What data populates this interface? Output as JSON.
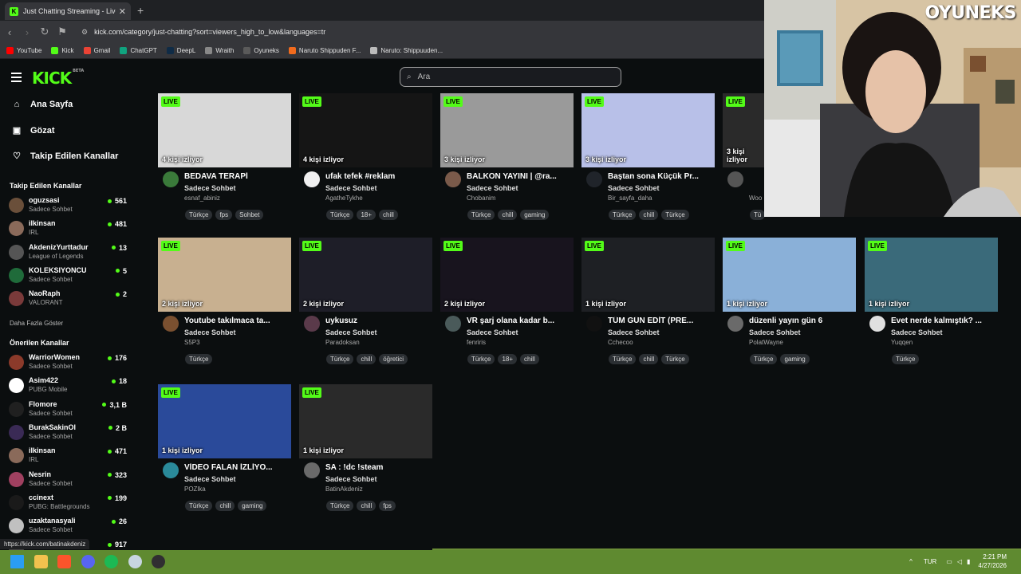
{
  "browser": {
    "tab_title": "Just Chatting Streaming - Live S",
    "url": "kick.com/category/just-chatting?sort=viewers_high_to_low&languages=tr",
    "bookmarks": [
      "YouTube",
      "Kick",
      "Gmail",
      "ChatGPT",
      "DeepL",
      "Wraith",
      "Oyuneks",
      "Naruto Shippuden F...",
      "Naruto: Shippuuden..."
    ],
    "bookmark_colors": [
      "#ff0000",
      "#53fc18",
      "#ea4335",
      "#10a37f",
      "#0f2b46",
      "#888888",
      "#5a5a5a",
      "#f26b1d",
      "#bbbbbb"
    ]
  },
  "header": {
    "logo": "KICK",
    "logo_badge": "BETA",
    "search_placeholder": "Ara"
  },
  "sidebar": {
    "nav": [
      {
        "label": "Ana Sayfa",
        "icon": "home-icon"
      },
      {
        "label": "Gözat",
        "icon": "browse-icon"
      },
      {
        "label": "Takip Edilen Kanallar",
        "icon": "heart-icon"
      }
    ],
    "followed_heading": "Takip Edilen Kanallar",
    "followed": [
      {
        "name": "oguzsasi",
        "sub": "Sadece Sohbet",
        "viewers": "561",
        "color": "#6a4f3a"
      },
      {
        "name": "ilkinsan",
        "sub": "IRL",
        "viewers": "481",
        "color": "#8a6a5a"
      },
      {
        "name": "AkdenizYurttadur",
        "sub": "League of Legends",
        "viewers": "13",
        "color": "#555555"
      },
      {
        "name": "KOLEKSIYONCU",
        "sub": "Sadece Sohbet",
        "viewers": "5",
        "color": "#1f6b3a"
      },
      {
        "name": "NaoRaph",
        "sub": "VALORANT",
        "viewers": "2",
        "color": "#7a3a3a"
      }
    ],
    "show_more": "Daha Fazla Göster",
    "recommended_heading": "Önerilen Kanallar",
    "recommended": [
      {
        "name": "WarriorWomen",
        "sub": "Sadece Sohbet",
        "viewers": "176",
        "color": "#8b3a2a"
      },
      {
        "name": "Asim422",
        "sub": "PUBG Mobile",
        "viewers": "18",
        "color": "#ffffff"
      },
      {
        "name": "Flomore",
        "sub": "Sadece Sohbet",
        "viewers": "3,1 B",
        "color": "#202020"
      },
      {
        "name": "BurakSakinOl",
        "sub": "Sadece Sohbet",
        "viewers": "2 B",
        "color": "#3a2a55"
      },
      {
        "name": "ilkinsan",
        "sub": "IRL",
        "viewers": "471",
        "color": "#8a6a5a"
      },
      {
        "name": "Nesrin",
        "sub": "Sadece Sohbet",
        "viewers": "323",
        "color": "#a04060"
      },
      {
        "name": "ccinext",
        "sub": "PUBG: Battlegrounds",
        "viewers": "199",
        "color": "#1a1a1a"
      },
      {
        "name": "uzaktanasyali",
        "sub": "Sadece Sohbet",
        "viewers": "26",
        "color": "#c0c0c0"
      },
      {
        "name": "",
        "sub": "",
        "viewers": "917",
        "color": "#444444"
      }
    ]
  },
  "live_label": "LIVE",
  "streams": [
    {
      "title": "BEDAVA TERAPİ",
      "category": "Sadece Sohbet",
      "user": "esnaf_abiniz",
      "viewers": "4 kişi izliyor",
      "tags": [
        "Türkçe",
        "fps",
        "Sohbet"
      ],
      "thumb": "#d8d8d8",
      "avatar": "#3a7a3a"
    },
    {
      "title": "ufak tefek #reklam",
      "category": "Sadece Sohbet",
      "user": "AgatheTykhe",
      "viewers": "4 kişi izliyor",
      "tags": [
        "Türkçe",
        "18+",
        "chill"
      ],
      "thumb": "#151515",
      "avatar": "#f0f0f0"
    },
    {
      "title": "BALKON YAYINI | @ra...",
      "category": "Sadece Sohbet",
      "user": "Chobanim",
      "viewers": "3 kişi izliyor",
      "tags": [
        "Türkçe",
        "chill",
        "gaming"
      ],
      "thumb": "#9a9a9a",
      "avatar": "#7a5a4a"
    },
    {
      "title": "Baştan sona Küçük Pr...",
      "category": "Sadece Sohbet",
      "user": "Bir_sayfa_daha",
      "viewers": "3 kişi izliyor",
      "tags": [
        "Türkçe",
        "chill",
        "Türkçe"
      ],
      "thumb": "#b8c0e8",
      "avatar": "#20242a"
    },
    {
      "title": "",
      "category": "",
      "user": "Woo",
      "viewers": "3 kişi izliyor",
      "tags": [
        "Tü"
      ],
      "thumb": "#2a2a2a",
      "avatar": "#555555"
    },
    {
      "title": "Youtube takılmaca ta...",
      "category": "Sadece Sohbet",
      "user": "S5P3",
      "viewers": "2 kişi izliyor",
      "tags": [
        "Türkçe"
      ],
      "thumb": "#c8b090",
      "avatar": "#7a5030"
    },
    {
      "title": "uykusuz",
      "category": "Sadece Sohbet",
      "user": "Paradoksan",
      "viewers": "2 kişi izliyor",
      "tags": [
        "Türkçe",
        "chill",
        "öğretici"
      ],
      "thumb": "#1e1e28",
      "avatar": "#5a3a4a"
    },
    {
      "title": "VR şarj olana kadar b...",
      "category": "Sadece Sohbet",
      "user": "fenriris",
      "viewers": "2 kişi izliyor",
      "tags": [
        "Türkçe",
        "18+",
        "chill"
      ],
      "thumb": "#18141e",
      "avatar": "#4a5a5a"
    },
    {
      "title": "TÜM GÜN EDİT (PRE...",
      "category": "Sadece Sohbet",
      "user": "Cchecoo",
      "viewers": "1 kişi izliyor",
      "tags": [
        "Türkçe",
        "chill",
        "Türkçe"
      ],
      "thumb": "#1e2024",
      "avatar": "#111111"
    },
    {
      "title": "düzenli yayın gün 6",
      "category": "Sadece Sohbet",
      "user": "PolatWayne",
      "viewers": "1 kişi izliyor",
      "tags": [
        "Türkçe",
        "gaming"
      ],
      "thumb": "#8ab0d8",
      "avatar": "#6a6a6a"
    },
    {
      "title": "Evet nerde kalmıştık? ...",
      "category": "Sadece Sohbet",
      "user": "Yuqqen",
      "viewers": "1 kişi izliyor",
      "tags": [
        "Türkçe"
      ],
      "thumb": "#3a6a7a",
      "avatar": "#e0e0e0"
    },
    {
      "title": "VİDEO FALAN İZLİYO...",
      "category": "Sadece Sohbet",
      "user": "POZlka",
      "viewers": "1 kişi izliyor",
      "tags": [
        "Türkçe",
        "chill",
        "gaming"
      ],
      "thumb": "#2a4a9a",
      "avatar": "#2a8a9a"
    },
    {
      "title": "SA : !dc !steam",
      "category": "Sadece Sohbet",
      "user": "BatinAkdeniz",
      "viewers": "1 kişi izliyor",
      "tags": [
        "Türkçe",
        "chill",
        "fps"
      ],
      "thumb": "#2a2a2a",
      "avatar": "#6a6a6a"
    }
  ],
  "overlay": {
    "brand": "OYUNEKS"
  },
  "statusbar": {
    "url": "https://kick.com/batinakdeniz"
  },
  "taskbar": {
    "lang": "TUR",
    "time": "2:21 PM",
    "date": "4/27/2026",
    "icons": [
      "windows-icon",
      "folder-icon",
      "brave-icon",
      "discord-icon",
      "spotify-icon",
      "steam-icon",
      "obs-icon"
    ]
  },
  "colors": {
    "accent": "#53fc18",
    "background": "#0b0e0f"
  }
}
